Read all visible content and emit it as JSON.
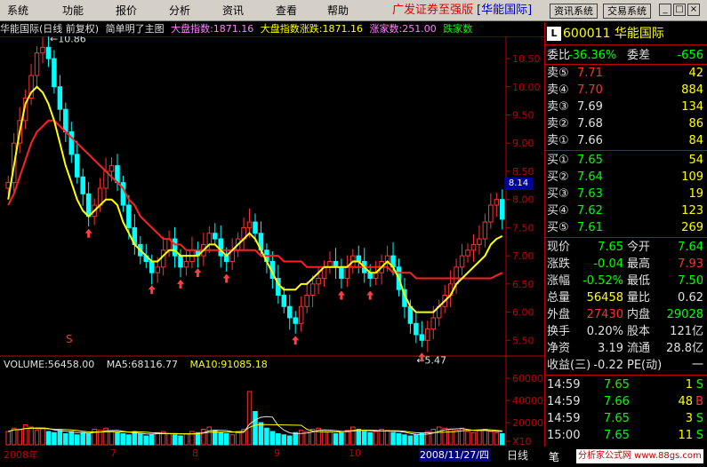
{
  "menu": {
    "items": [
      "系统",
      "功能",
      "报价",
      "分析",
      "资讯",
      "查看",
      "帮助"
    ],
    "brand": "广发证券至强版",
    "stock_name": "[华能国际]",
    "buttons": [
      "资讯系统",
      "交易系统"
    ]
  },
  "chart_header": {
    "title": "华能国际(日线 前复权)",
    "desc": "简单明了主图",
    "index": "大盘指数:1871.16",
    "index_change": "大盘指数涨跌:1871.16",
    "up_count": "涨家数:251.00",
    "down_count": "跌家数"
  },
  "volume_header": {
    "volume": "VOLUME:56458.00",
    "ma5": "MA5:68116.77",
    "ma10": "MA10:91085.18"
  },
  "colors": {
    "up": "#ff3333",
    "down": "#00ffff",
    "ma_fast": "#ffff00",
    "ma_slow": "#ff2020",
    "axis": "#c00000"
  },
  "chart_data": {
    "type": "candlestick",
    "y_ticks": [
      "10.50",
      "10.00",
      "9.50",
      "9.00",
      "8.50",
      "8.00",
      "7.50",
      "7.00",
      "6.50",
      "6.00",
      "5.50"
    ],
    "ylim": [
      5.3,
      10.8
    ],
    "high_label": "10.86",
    "low_label": "5.47",
    "current_price_label": "8.14",
    "x_labels": [
      "2008年",
      "7",
      "8",
      "9",
      "10",
      "11"
    ],
    "volume_ticks": [
      "60000",
      "40000",
      "20000",
      "X10"
    ],
    "volume_ylim": [
      0,
      64000
    ],
    "signal_label": "S",
    "close": [
      8.3,
      9.0,
      9.4,
      9.8,
      10.2,
      10.6,
      10.7,
      10.5,
      10.0,
      9.6,
      9.2,
      8.8,
      8.4,
      8.1,
      7.7,
      7.9,
      8.2,
      8.5,
      8.6,
      8.3,
      7.9,
      7.5,
      7.2,
      7.0,
      6.9,
      6.7,
      6.8,
      7.1,
      7.3,
      7.0,
      6.8,
      6.9,
      7.1,
      7.0,
      7.2,
      7.4,
      7.3,
      7.0,
      6.9,
      7.1,
      7.3,
      7.5,
      7.6,
      7.4,
      7.1,
      6.9,
      6.6,
      6.3,
      6.1,
      5.9,
      5.8,
      6.1,
      6.3,
      6.5,
      6.6,
      6.8,
      6.9,
      6.8,
      6.6,
      6.8,
      7.0,
      6.9,
      6.7,
      6.6,
      6.7,
      6.9,
      7.0,
      6.8,
      6.4,
      6.1,
      5.8,
      5.6,
      5.5,
      5.7,
      5.9,
      6.1,
      6.3,
      6.5,
      6.8,
      7.0,
      7.1,
      7.2,
      7.3,
      7.6,
      7.9,
      8.0,
      7.65
    ],
    "ma_fast": [
      8.0,
      8.6,
      9.2,
      9.7,
      9.9,
      10.0,
      9.9,
      9.7,
      9.4,
      9.0,
      8.6,
      8.3,
      8.0,
      7.8,
      7.7,
      7.8,
      7.9,
      8.0,
      8.0,
      7.9,
      7.6,
      7.4,
      7.2,
      7.1,
      7.0,
      6.9,
      6.9,
      7.0,
      7.1,
      7.1,
      7.0,
      7.0,
      7.0,
      7.0,
      7.1,
      7.2,
      7.2,
      7.1,
      7.0,
      7.1,
      7.2,
      7.3,
      7.4,
      7.3,
      7.1,
      6.9,
      6.7,
      6.5,
      6.4,
      6.4,
      6.4,
      6.5,
      6.5,
      6.6,
      6.7,
      6.8,
      6.8,
      6.8,
      6.8,
      6.8,
      6.9,
      6.9,
      6.8,
      6.7,
      6.7,
      6.8,
      6.9,
      6.8,
      6.6,
      6.3,
      6.1,
      6.0,
      6.0,
      6.0,
      6.0,
      6.1,
      6.2,
      6.3,
      6.5,
      6.6,
      6.7,
      6.8,
      6.9,
      7.0,
      7.2,
      7.3,
      7.35
    ],
    "ma_slow": [
      7.9,
      8.1,
      8.4,
      8.7,
      9.0,
      9.2,
      9.3,
      9.4,
      9.4,
      9.3,
      9.2,
      9.1,
      9.0,
      8.9,
      8.8,
      8.7,
      8.6,
      8.5,
      8.4,
      8.3,
      8.2,
      8.0,
      7.9,
      7.7,
      7.6,
      7.5,
      7.4,
      7.3,
      7.3,
      7.2,
      7.2,
      7.1,
      7.1,
      7.1,
      7.1,
      7.1,
      7.1,
      7.1,
      7.1,
      7.1,
      7.1,
      7.1,
      7.1,
      7.1,
      7.0,
      7.0,
      7.0,
      7.0,
      6.9,
      6.9,
      6.9,
      6.9,
      6.8,
      6.8,
      6.8,
      6.8,
      6.8,
      6.8,
      6.8,
      6.8,
      6.8,
      6.8,
      6.8,
      6.8,
      6.8,
      6.8,
      6.8,
      6.7,
      6.7,
      6.7,
      6.7,
      6.6,
      6.6,
      6.6,
      6.6,
      6.6,
      6.6,
      6.6,
      6.6,
      6.6,
      6.6,
      6.6,
      6.6,
      6.6,
      6.6,
      6.65,
      6.7
    ],
    "volume": [
      12000,
      15000,
      14000,
      18000,
      16000,
      13000,
      15000,
      12000,
      11000,
      13000,
      10000,
      12000,
      9000,
      11000,
      10000,
      14000,
      13000,
      15000,
      12000,
      11000,
      10000,
      9000,
      12000,
      10000,
      8000,
      9000,
      11000,
      12000,
      10000,
      9000,
      8000,
      10000,
      12000,
      11000,
      14000,
      16000,
      13000,
      11000,
      10000,
      9000,
      12000,
      14000,
      48000,
      30000,
      20000,
      15000,
      12000,
      10000,
      9000,
      8000,
      11000,
      13000,
      12000,
      14000,
      15000,
      13000,
      12000,
      10000,
      11000,
      13000,
      16000,
      14000,
      12000,
      11000,
      12000,
      14000,
      13000,
      11000,
      10000,
      9000,
      8000,
      9000,
      10000,
      12000,
      14000,
      16000,
      15000,
      14000,
      13000,
      15000,
      12000,
      11000,
      13000,
      14000,
      12000,
      11000,
      10000
    ]
  },
  "quote": {
    "code": "600011",
    "name": "华能国际",
    "weibi_label": "委比",
    "weibi_value": "-36.36%",
    "weicha_label": "委差",
    "weicha_value": "-656",
    "sells": [
      {
        "label": "卖⑤",
        "price": "7.71",
        "vol": "42"
      },
      {
        "label": "卖④",
        "price": "7.70",
        "vol": "884"
      },
      {
        "label": "卖③",
        "price": "7.69",
        "vol": "134"
      },
      {
        "label": "卖②",
        "price": "7.68",
        "vol": "86"
      },
      {
        "label": "卖①",
        "price": "7.66",
        "vol": "84"
      }
    ],
    "buys": [
      {
        "label": "买①",
        "price": "7.65",
        "vol": "54"
      },
      {
        "label": "买②",
        "price": "7.64",
        "vol": "109"
      },
      {
        "label": "买③",
        "price": "7.63",
        "vol": "19"
      },
      {
        "label": "买④",
        "price": "7.62",
        "vol": "123"
      },
      {
        "label": "买⑤",
        "price": "7.61",
        "vol": "269"
      }
    ],
    "stats": [
      {
        "l1": "现价",
        "v1": "7.65",
        "l2": "今开",
        "v2": "7.64"
      },
      {
        "l1": "涨跌",
        "v1": "-0.04",
        "l2": "最高",
        "v2": "7.93"
      },
      {
        "l1": "涨幅",
        "v1": "-0.52%",
        "l2": "最低",
        "v2": "7.50"
      },
      {
        "l1": "总量",
        "v1": "56458",
        "l2": "量比",
        "v2": "0.62"
      },
      {
        "l1": "外盘",
        "v1": "27430",
        "l2": "内盘",
        "v2": "29028"
      },
      {
        "l1": "换手",
        "v1": "0.20%",
        "l2": "股本",
        "v2": "121亿"
      },
      {
        "l1": "净资",
        "v1": "3.19",
        "l2": "流通",
        "v2": "28.8亿"
      },
      {
        "l1": "收益(三)",
        "v1": "-0.22",
        "l2": "PE(动)",
        "v2": "一"
      }
    ],
    "ticks": [
      {
        "time": "14:59",
        "price": "7.65",
        "vol": "1",
        "flag": "S"
      },
      {
        "time": "14:59",
        "price": "7.66",
        "vol": "48",
        "flag": "B"
      },
      {
        "time": "14:59",
        "price": "7.65",
        "vol": "3",
        "flag": "S"
      },
      {
        "time": "15:00",
        "price": "7.65",
        "vol": "11",
        "flag": "S"
      }
    ]
  },
  "footer": {
    "date": "2008/11/27/四",
    "period": "日线",
    "bi_label": "笔",
    "watermark": "分析家公式网 www.88gs.com"
  }
}
